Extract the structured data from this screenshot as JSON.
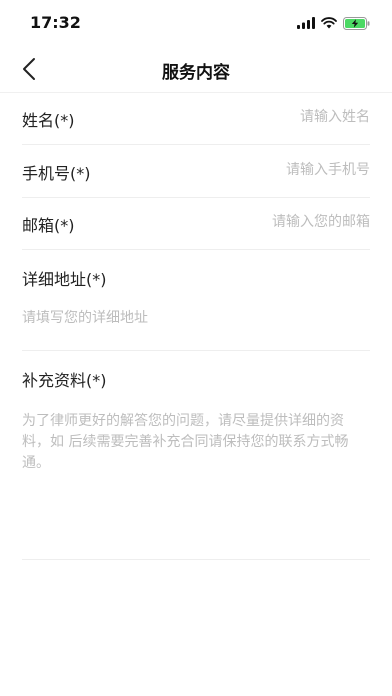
{
  "status_bar": {
    "time": "17:32"
  },
  "nav": {
    "title": "服务内容"
  },
  "form": {
    "name": {
      "label": "姓名(*)",
      "placeholder": "请输入姓名"
    },
    "phone": {
      "label": "手机号(*)",
      "placeholder": "请输入手机号"
    },
    "email": {
      "label": "邮箱(*)",
      "placeholder": "请输入您的邮箱"
    },
    "address": {
      "label": "详细地址(*)",
      "placeholder": "请填写您的详细地址"
    },
    "supplement": {
      "label": "补充资料(*)",
      "placeholder": "为了律师更好的解答您的问题，请尽量提供详细的资料，如 后续需要完善补充合同请保持您的联系方式畅通。"
    }
  },
  "colors": {
    "battery_fill": "#4cd964",
    "placeholder": "#bdbdbd",
    "divider": "#eeeeee"
  }
}
